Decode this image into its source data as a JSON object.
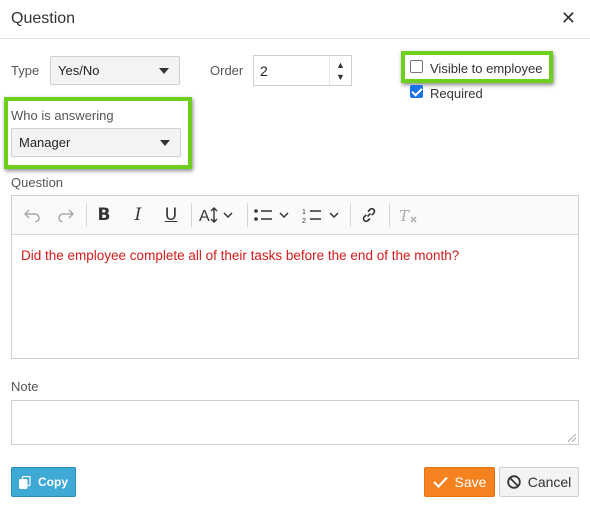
{
  "dialog": {
    "title": "Question",
    "close_glyph": "✕"
  },
  "type_field": {
    "label": "Type",
    "value": "Yes/No"
  },
  "order_field": {
    "label": "Order",
    "value": "2"
  },
  "visible_to_employee": {
    "label": "Visible to employee",
    "checked": false
  },
  "required": {
    "label": "Required",
    "checked": true
  },
  "who_answering": {
    "label": "Who is answering",
    "value": "Manager"
  },
  "question": {
    "label": "Question",
    "text": "Did the employee complete all of their tasks before the end of the month?",
    "toolbar": [
      "undo-icon",
      "redo-icon",
      "bold-icon",
      "italic-icon",
      "underline-icon",
      "font-size-icon",
      "bulleted-list-icon",
      "numbered-list-icon",
      "link-icon",
      "remove-format-icon"
    ]
  },
  "note": {
    "label": "Note",
    "value": ""
  },
  "buttons": {
    "copy": "Copy",
    "save": "Save",
    "cancel": "Cancel"
  },
  "colors": {
    "highlight_green": "#6fcf1f",
    "save_orange": "#f5821f",
    "copy_blue": "#3fa9d6",
    "question_text_red": "#d41a1a"
  }
}
